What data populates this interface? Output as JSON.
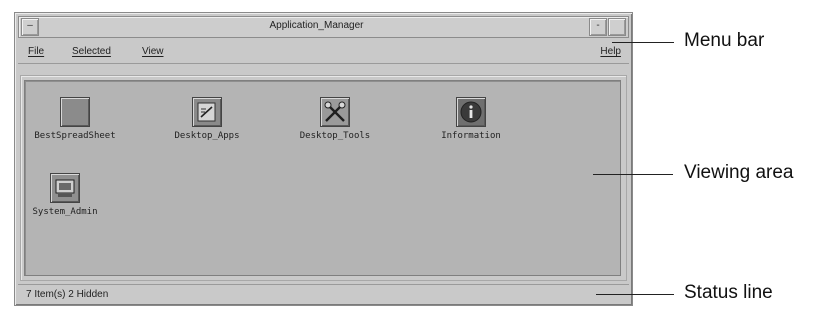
{
  "window": {
    "title": "Application_Manager",
    "menu_button": "–",
    "minimize_button": "-",
    "maximize_button": ""
  },
  "menubar": {
    "items": [
      "File",
      "Selected",
      "View"
    ],
    "help": "Help"
  },
  "apps": [
    {
      "label": "BestSpreadSheet",
      "icon": "spreadsheet-icon"
    },
    {
      "label": "Desktop_Apps",
      "icon": "desktop-apps-icon"
    },
    {
      "label": "Desktop_Tools",
      "icon": "desktop-tools-icon"
    },
    {
      "label": "Information",
      "icon": "information-icon"
    },
    {
      "label": "System_Admin",
      "icon": "system-admin-icon"
    }
  ],
  "status": {
    "text": "7 Item(s) 2 Hidden"
  },
  "callouts": {
    "menu_bar": "Menu bar",
    "viewing_area": "Viewing area",
    "status_line": "Status line"
  },
  "colors": {
    "window_bg": "#c9c9c9",
    "viewing_bg": "#b4b4b4"
  }
}
